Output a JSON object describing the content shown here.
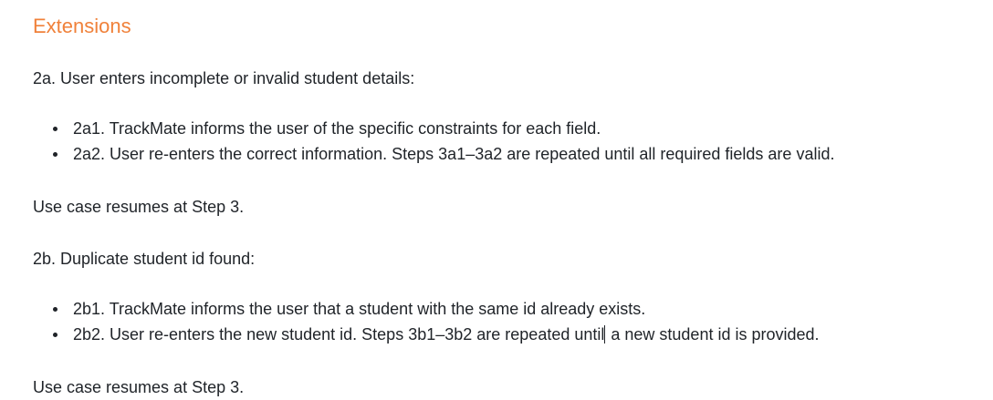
{
  "heading": "Extensions",
  "ext_2a": {
    "title": "2a. User enters incomplete or invalid student details:",
    "steps": [
      "2a1. TrackMate informs the user of the specific constraints for each field.",
      "2a2. User re-enters the correct information. Steps 3a1–3a2 are repeated until all required fields are valid."
    ],
    "resume": "Use case resumes at Step 3."
  },
  "ext_2b": {
    "title": "2b. Duplicate student id found:",
    "steps": [
      "2b1. TrackMate informs the user that a student with the same id already exists."
    ],
    "step2_before_cursor": "2b2. User re-enters the new student id. Steps 3b1–3b2 are repeated until",
    "step2_after_cursor": " a new student id is provided.",
    "resume": "Use case resumes at Step 3."
  }
}
